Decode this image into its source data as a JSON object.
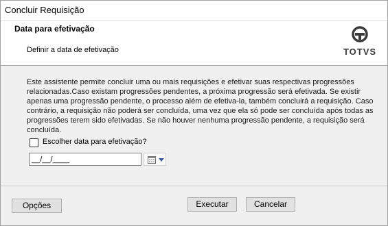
{
  "window": {
    "title": "Concluir Requisição"
  },
  "header": {
    "title": "Data para efetivação",
    "subtitle": "Definir a data de efetivação",
    "logo_text": "TOTVS"
  },
  "body": {
    "description": "Este assistente permite concluir uma ou mais requisições e efetivar suas respectivas progressões relacionadas.Caso existam progressões pendentes, a próxima progressão será efetivada. Se existir apenas uma progressão pendente, o processo além de efetiva-la, também concluirá a requisição. Caso contrário, a requisição não poderá ser concluída, uma vez que ela só pode ser concluída após todas as progressões terem sido efetivadas. Se não houver nenhuma progressão pendente, a requisição será concluída.",
    "checkbox_label": "Escolher data para efetivação?",
    "checkbox_checked": false,
    "date_value": "__/__/____"
  },
  "footer": {
    "options_label": "Opções",
    "execute_label": "Executar",
    "cancel_label": "Cancelar"
  },
  "icons": {
    "logo": "totvs-logo-icon",
    "calendar": "calendar-icon",
    "dropdown": "chevron-down-icon"
  }
}
